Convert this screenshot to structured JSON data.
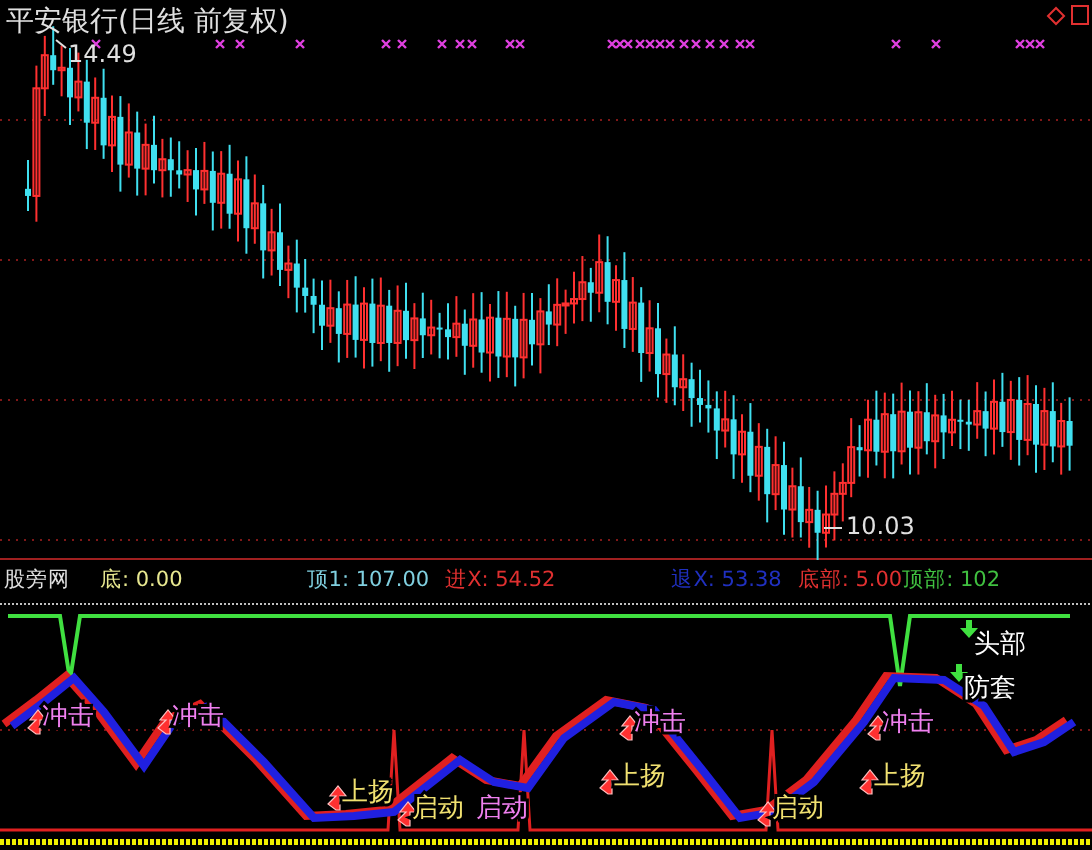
{
  "price_panel": {
    "title": "平安银行(日线 前复权)",
    "high_label": "14.49",
    "low_label": "10.03"
  },
  "indicator_panel": {
    "name": "股旁网",
    "readouts": [
      {
        "label": "底: 0.00",
        "color": "#e8e890"
      },
      {
        "label": "顶1: 107.00",
        "color": "#80d0e0"
      },
      {
        "label": "进X: 54.52",
        "color": "#e03030"
      },
      {
        "label": "退X: 53.38",
        "color": "#2030c0"
      },
      {
        "label": "底部: 5.00",
        "color": "#e03030"
      },
      {
        "label": "顶部: 102",
        "color": "#40c040"
      }
    ],
    "signals": [
      {
        "text": "冲击",
        "kind": "up"
      },
      {
        "text": "冲击",
        "kind": "up"
      },
      {
        "text": "上扬",
        "kind": "up"
      },
      {
        "text": "启动",
        "kind": "up"
      },
      {
        "text": "启动",
        "kind": "none"
      },
      {
        "text": "冲击",
        "kind": "up"
      },
      {
        "text": "上扬",
        "kind": "up"
      },
      {
        "text": "启动",
        "kind": "up"
      },
      {
        "text": "上扬",
        "kind": "up"
      },
      {
        "text": "冲击",
        "kind": "up"
      },
      {
        "text": "头部",
        "kind": "down"
      },
      {
        "text": "防套",
        "kind": "down"
      }
    ]
  }
}
